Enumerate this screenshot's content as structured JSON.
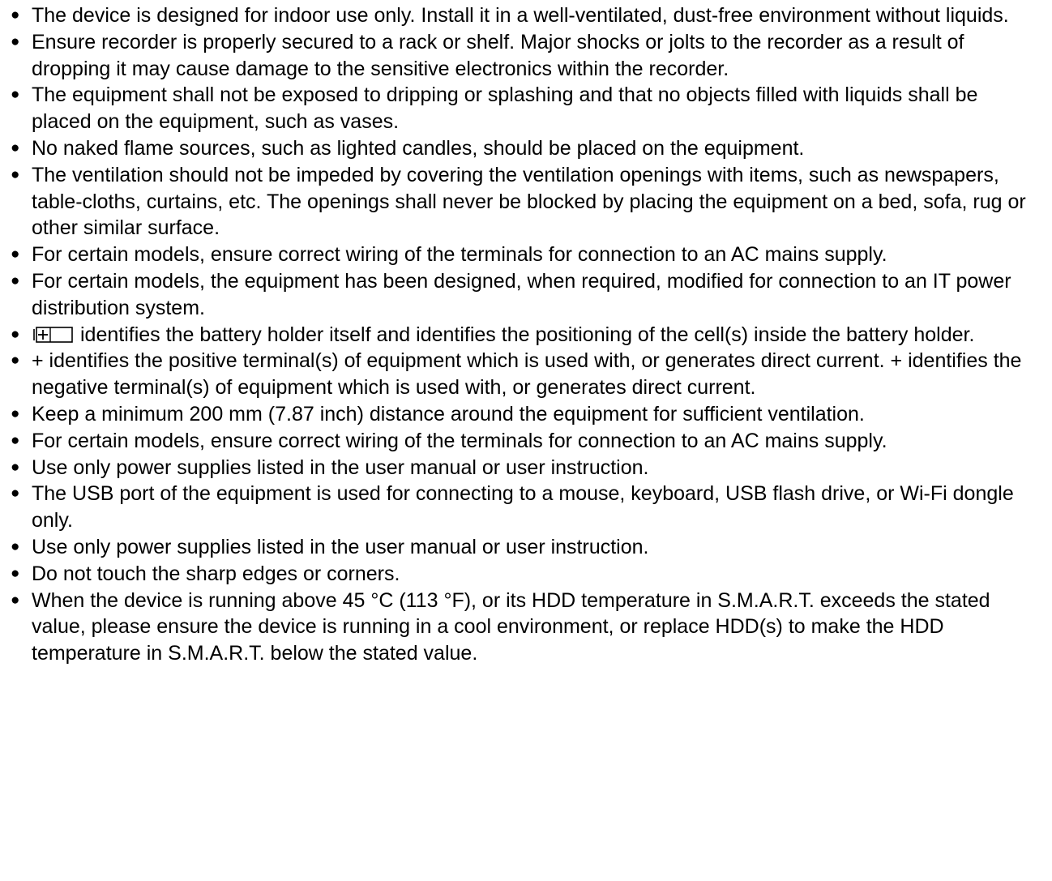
{
  "bullet_glyph": "●",
  "items": [
    "The device is designed for indoor use only. Install it in a well-ventilated, dust-free environment without liquids.",
    "Ensure recorder is properly secured to a rack or shelf. Major shocks or jolts to the recorder as a result of dropping it may cause damage to the sensitive electronics within the recorder.",
    "The equipment shall not be exposed to dripping or splashing and that no objects filled with liquids shall be placed on the equipment, such as vases.",
    "No naked flame sources, such as lighted candles, should be placed on the equipment.",
    "The ventilation should not be impeded by covering the ventilation openings with items, such as newspapers, table-cloths, curtains, etc. The openings shall never be blocked by placing the equipment on a bed, sofa, rug or other similar surface.",
    "For certain models, ensure correct wiring of the terminals for connection to an AC mains supply.",
    "For certain models, the equipment has been designed, when required, modified for connection to an IT power distribution system.",
    "identifies the battery holder itself and identifies the positioning of the cell(s) inside the battery holder.",
    "+ identifies the positive terminal(s) of equipment which is used with, or generates direct current. + identifies the negative terminal(s) of equipment which is used with, or generates direct current.",
    "Keep a minimum 200 mm (7.87 inch) distance around the equipment for sufficient ventilation.",
    "For certain models, ensure correct wiring of the terminals for connection to an AC mains supply.",
    "Use only power supplies listed in the user manual or user instruction.",
    "The USB port of the equipment is used for connecting to a mouse, keyboard, USB flash drive, or Wi-Fi dongle only.",
    "Use only power supplies listed in the user manual or user instruction.",
    "Do not touch the sharp edges or corners.",
    "When the device is running above 45 °C (113 °F), or its HDD temperature in S.M.A.R.T. exceeds the stated value, please ensure the device is running in a cool environment, or replace HDD(s) to make the HDD temperature in S.M.A.R.T. below the stated value."
  ],
  "icons": {
    "item_8": "battery-holder-icon"
  }
}
